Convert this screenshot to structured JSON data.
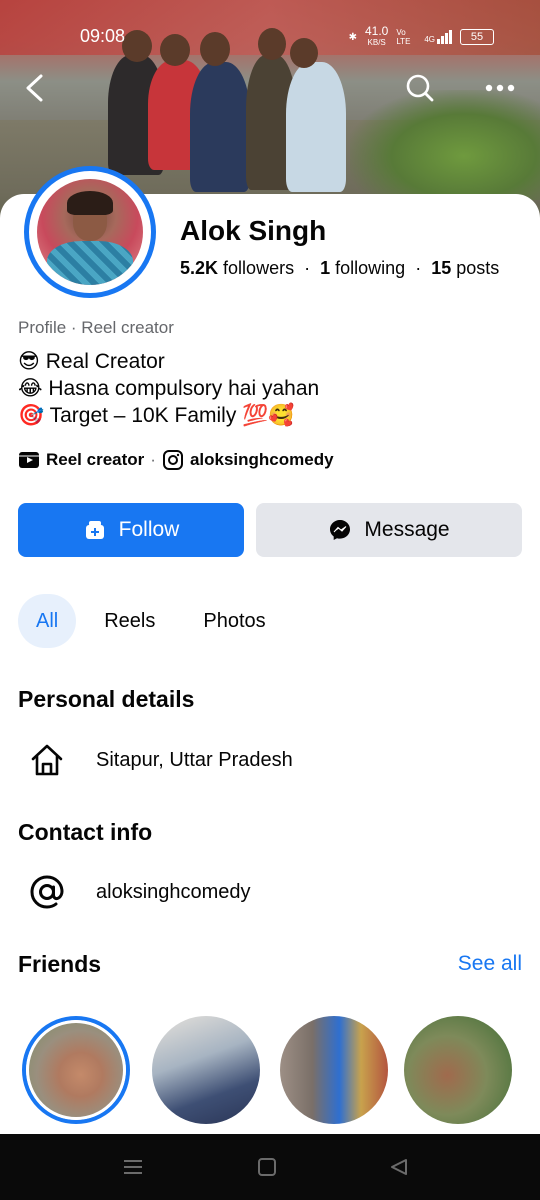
{
  "status_bar": {
    "time": "09:08",
    "net_speed": "41.0",
    "net_unit": "KB/S",
    "volte": "Vo LTE",
    "signal": "4G",
    "battery": "55"
  },
  "nav": {
    "back_icon": "back-arrow-icon",
    "search_icon": "search-icon",
    "more_icon": "more-icon"
  },
  "profile": {
    "name": "Alok Singh",
    "followers_count": "5.2K",
    "followers_label": "followers",
    "following_count": "1",
    "following_label": "following",
    "posts_count": "15",
    "posts_label": "posts",
    "sub_label": "Profile · Reel creator",
    "bio": [
      "😎 Real Creator",
      "😂 Hasna compulsory hai yahan",
      "🎯 Target – 10K Family 💯🥰"
    ],
    "reel_creator": "Reel creator",
    "instagram": "aloksinghcomedy"
  },
  "actions": {
    "follow": "Follow",
    "message": "Message"
  },
  "tabs": [
    {
      "label": "All",
      "active": true
    },
    {
      "label": "Reels",
      "active": false
    },
    {
      "label": "Photos",
      "active": false
    }
  ],
  "personal_details": {
    "title": "Personal details",
    "location": "Sitapur, Uttar Pradesh"
  },
  "contact_info": {
    "title": "Contact info",
    "handle": "aloksinghcomedy"
  },
  "friends": {
    "title": "Friends",
    "see_all": "See all"
  },
  "colors": {
    "accent": "#1877f2",
    "secondary_button": "#e4e6eb",
    "muted_text": "#65676b"
  }
}
